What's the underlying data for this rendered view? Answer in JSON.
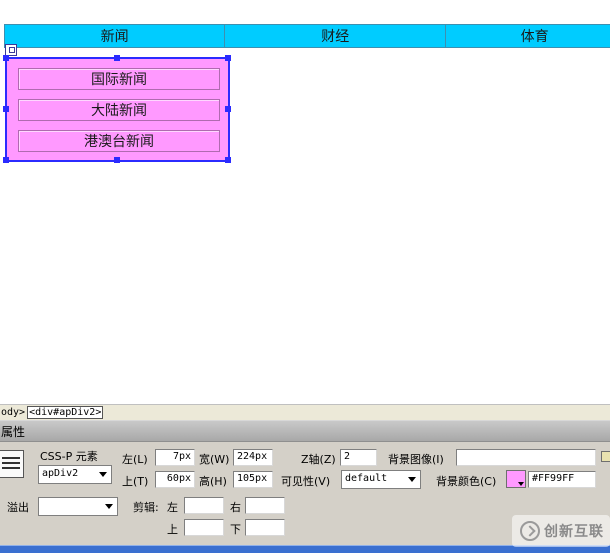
{
  "nav": {
    "items": [
      "新闻",
      "财经",
      "体育"
    ]
  },
  "layer": {
    "items": [
      "国际新闻",
      "大陆新闻",
      "港澳台新闻"
    ]
  },
  "tag_selector": {
    "body_tag": "ody>",
    "div_tag": "<div#apDiv2>"
  },
  "properties": {
    "title": "属性",
    "element_type": "CSS-P 元素",
    "id_value": "apDiv2",
    "left_label": "左(L)",
    "left_value": "7px",
    "width_label": "宽(W)",
    "width_value": "224px",
    "zindex_label": "Z轴(Z)",
    "zindex_value": "2",
    "bg_image_label": "背景图像(I)",
    "bg_image_value": "",
    "top_label": "上(T)",
    "top_value": "60px",
    "height_label": "高(H)",
    "height_value": "105px",
    "visibility_label": "可见性(V)",
    "visibility_value": "default",
    "bg_color_label": "背景颜色(C)",
    "bg_color_value": "#FF99FF",
    "overflow_label": "溢出",
    "overflow_value": "",
    "clip_label": "剪辑:",
    "clip_left_label": "左",
    "clip_right_label": "右",
    "clip_top_label": "上",
    "clip_bottom_label": "下",
    "clip_left_value": "",
    "clip_right_value": "",
    "clip_top_value": "",
    "clip_bottom_value": ""
  },
  "watermark": {
    "text": "创新互联"
  },
  "colors": {
    "nav_bg": "#00ccff",
    "layer_bg": "#ff99ff",
    "layer_border": "#2b2bff"
  }
}
